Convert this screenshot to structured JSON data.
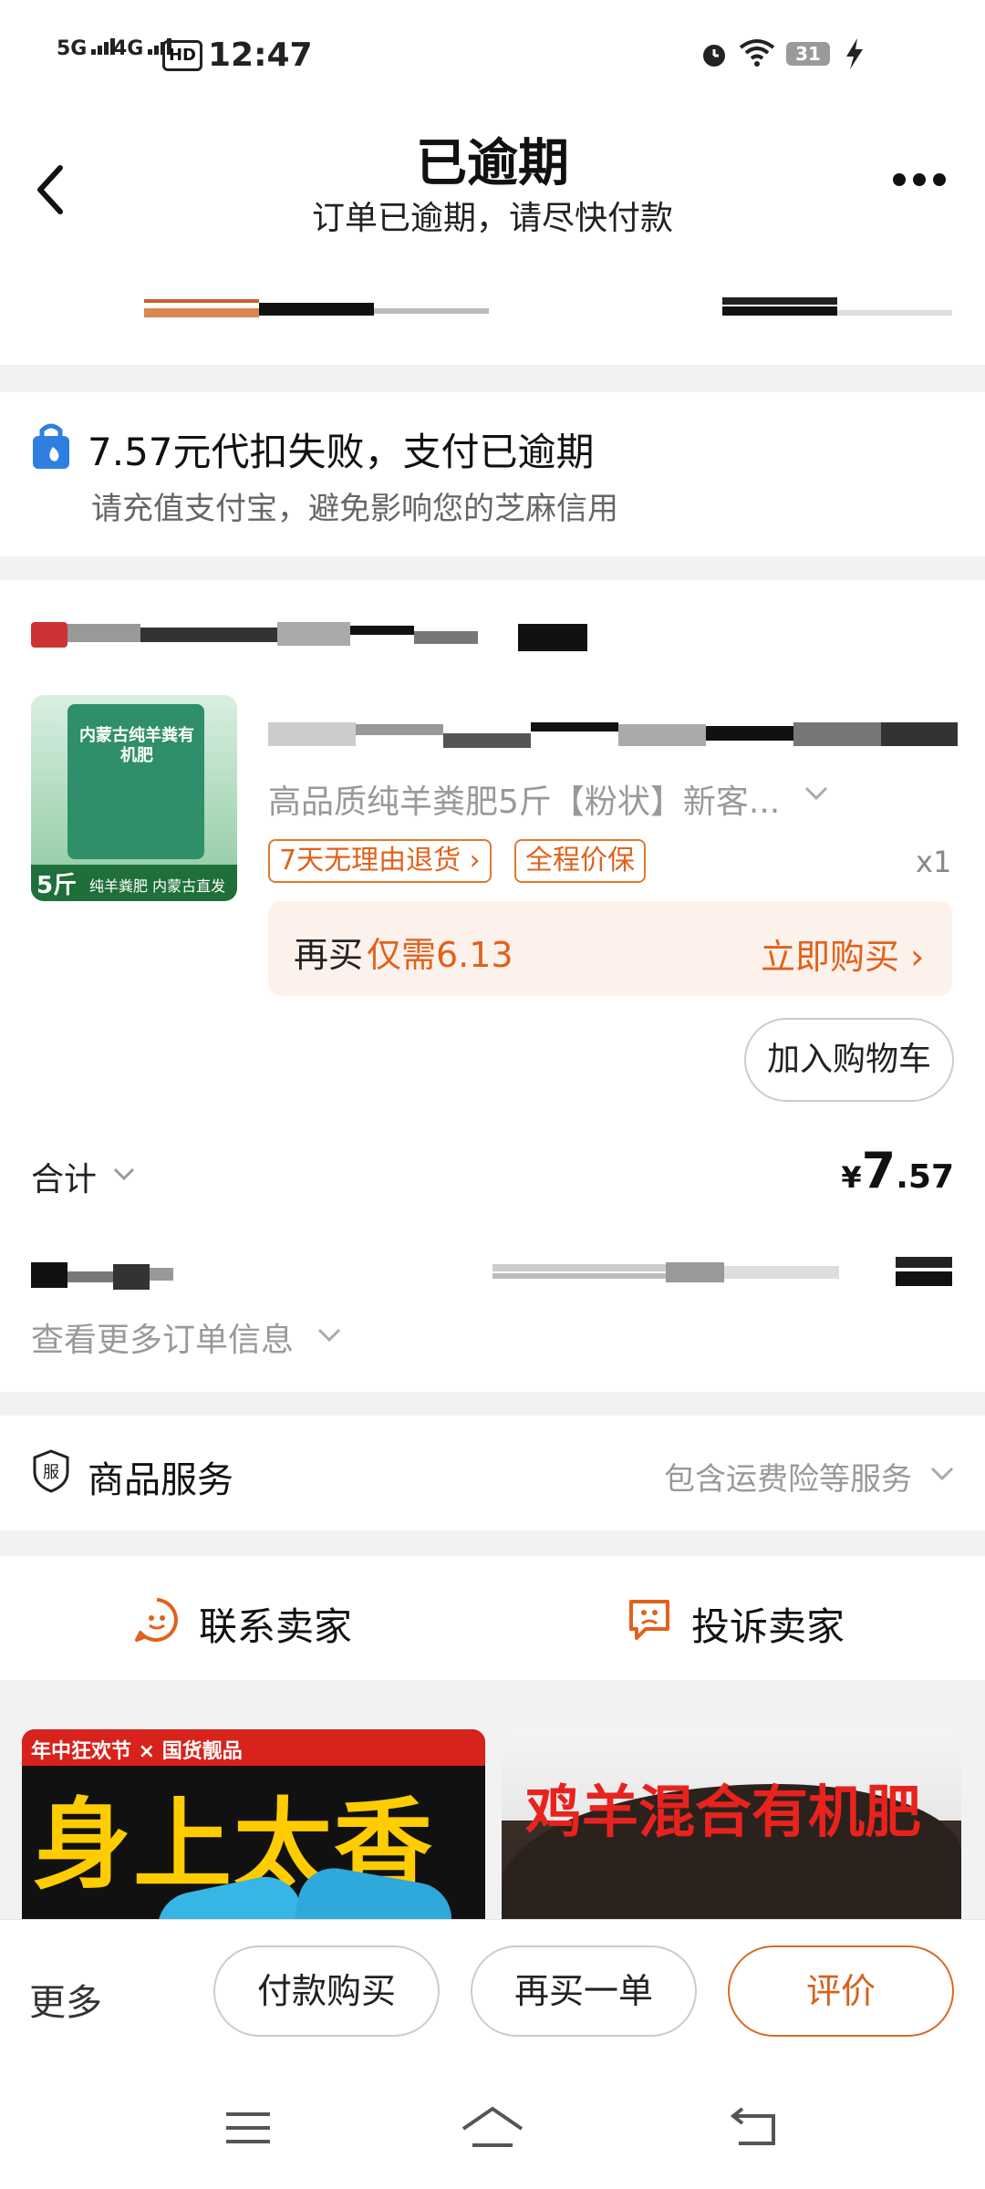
{
  "status_bar": {
    "sig1": "5G",
    "sig2": "4G",
    "hd": "HD",
    "time": "12:47",
    "battery": "31"
  },
  "header": {
    "title": "已逾期",
    "subtitle": "订单已逾期，请尽快付款"
  },
  "notice": {
    "title": "7.57元代扣失败，支付已逾期",
    "subtitle": "请充值支付宝，避免影响您的芝麻信用"
  },
  "product": {
    "image_text_banner": "内蒙古纯羊粪有机肥",
    "image_weight": "5斤",
    "image_footer": "纯羊粪肥 内蒙古直发",
    "spec": "高品质纯羊粪肥5斤【粉状】新客...",
    "tags": [
      "7天无理由退货 ›",
      "全程价保"
    ],
    "qty": "x1",
    "rebuy_prefix": "再买",
    "rebuy_price": "仅需6.13",
    "buy_now": "立即购买 ›",
    "add_cart": "加入购物车"
  },
  "total": {
    "label": "合计",
    "currency": "¥",
    "int": "7",
    "dec": ".57"
  },
  "order_info": {
    "more": "查看更多订单信息"
  },
  "service": {
    "icon_char": "服",
    "label": "商品服务",
    "detail": "包含运费险等服务"
  },
  "contact": {
    "seller": "联系卖家",
    "complain": "投诉卖家"
  },
  "recommend": {
    "left_badge": "年中狂欢节 × 国货靓品",
    "left_text": "身上太香了",
    "right_text": "鸡羊混合有机肥"
  },
  "bottom_bar": {
    "more": "更多",
    "pay": "付款购买",
    "rebuy": "再买一单",
    "review": "评价"
  },
  "colors": {
    "accent": "#e0621c",
    "price": "#d8601f"
  }
}
